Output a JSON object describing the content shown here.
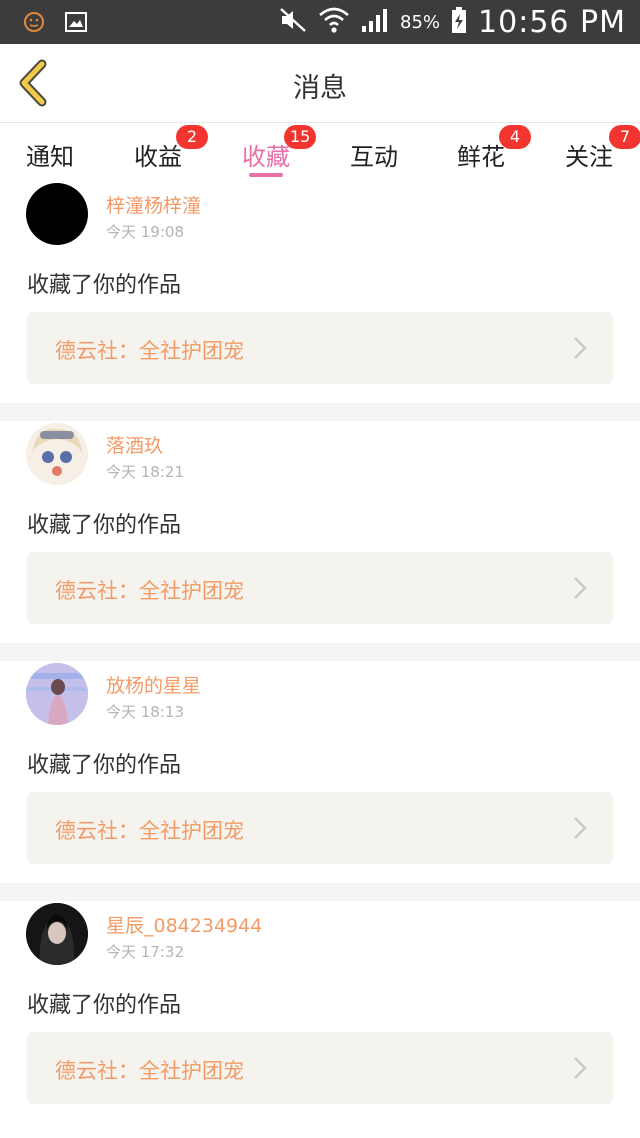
{
  "status_bar": {
    "battery_percent": "85%",
    "time": "10:56 PM",
    "icons": [
      "notification-face-icon",
      "gallery-icon",
      "mute-icon",
      "wifi-icon",
      "signal-icon",
      "battery-icon"
    ]
  },
  "header": {
    "title": "消息",
    "back_icon": "chevron-left-icon",
    "accent_color": "#f2c94c"
  },
  "tabs": [
    {
      "label": "通知",
      "badge": ""
    },
    {
      "label": "收益",
      "badge": "2"
    },
    {
      "label": "收藏",
      "badge": "15",
      "active": true
    },
    {
      "label": "互动",
      "badge": ""
    },
    {
      "label": "鲜花",
      "badge": "4"
    },
    {
      "label": "关注",
      "badge": "7"
    }
  ],
  "colors": {
    "active_tab": "#e86fa8",
    "badge": "#f2362f",
    "username": "#f39b66",
    "work_box_bg": "#f4f3ee"
  },
  "feed": [
    {
      "username": "梓潼杨梓潼",
      "time": "今天 19:08",
      "action": "收藏了你的作品",
      "work": "德云社：全社护团宠"
    },
    {
      "username": "落酒玖",
      "time": "今天 18:21",
      "action": "收藏了你的作品",
      "work": "德云社：全社护团宠"
    },
    {
      "username": "放杨的星星",
      "time": "今天 18:13",
      "action": "收藏了你的作品",
      "work": "德云社：全社护团宠"
    },
    {
      "username": "星辰_084234944",
      "time": "今天 17:32",
      "action": "收藏了你的作品",
      "work": "德云社：全社护团宠"
    }
  ]
}
